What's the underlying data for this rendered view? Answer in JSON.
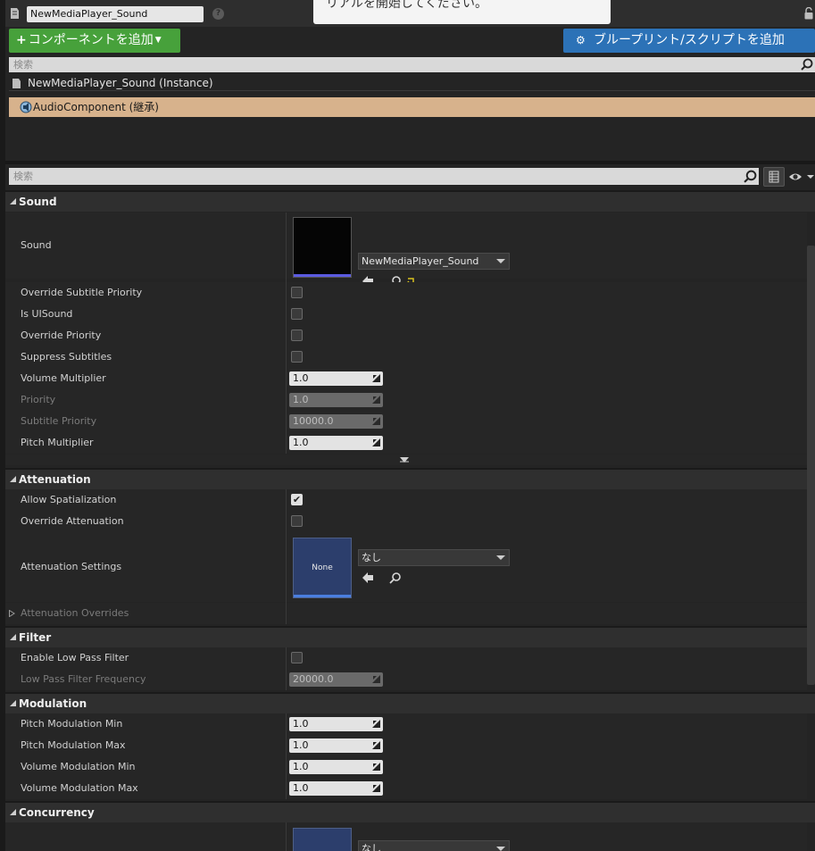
{
  "header": {
    "actor_name": "NewMediaPlayer_Sound",
    "tooltip_text": "リアルを開始してください。"
  },
  "toolbar": {
    "add_component_label": "コンポーネントを追加",
    "blueprint_label": "ブループリント/スクリプトを追加"
  },
  "component_search": {
    "placeholder": "検索"
  },
  "components": {
    "instance_label": "NewMediaPlayer_Sound (Instance)",
    "selected_label": "AudioComponent (継承)"
  },
  "details_search": {
    "placeholder": "検索"
  },
  "sections": {
    "sound": {
      "title": "Sound",
      "sound_label": "Sound",
      "sound_asset": "NewMediaPlayer_Sound",
      "override_subtitle_priority_label": "Override Subtitle Priority",
      "is_uisound_label": "Is UISound",
      "override_priority_label": "Override Priority",
      "suppress_subtitles_label": "Suppress Subtitles",
      "volume_multiplier_label": "Volume Multiplier",
      "volume_multiplier_value": "1.0",
      "priority_label": "Priority",
      "priority_value": "1.0",
      "subtitle_priority_label": "Subtitle Priority",
      "subtitle_priority_value": "10000.0",
      "pitch_multiplier_label": "Pitch Multiplier",
      "pitch_multiplier_value": "1.0"
    },
    "attenuation": {
      "title": "Attenuation",
      "allow_spatialization_label": "Allow Spatialization",
      "allow_spatialization_checked": true,
      "override_attenuation_label": "Override Attenuation",
      "attenuation_settings_label": "Attenuation Settings",
      "attenuation_settings_asset": "なし",
      "thumbnail_text": "None",
      "attenuation_overrides_label": "Attenuation Overrides"
    },
    "filter": {
      "title": "Filter",
      "enable_low_pass_label": "Enable Low Pass Filter",
      "low_pass_frequency_label": "Low Pass Filter Frequency",
      "low_pass_frequency_value": "20000.0"
    },
    "modulation": {
      "title": "Modulation",
      "pitch_min_label": "Pitch Modulation Min",
      "pitch_min_value": "1.0",
      "pitch_max_label": "Pitch Modulation Max",
      "pitch_max_value": "1.0",
      "volume_min_label": "Volume Modulation Min",
      "volume_min_value": "1.0",
      "volume_max_label": "Volume Modulation Max",
      "volume_max_value": "1.0"
    },
    "concurrency": {
      "title": "Concurrency",
      "asset": "なし"
    }
  },
  "colors": {
    "add_button": "#47a13b",
    "blueprint_button": "#2c72b7",
    "selected_component": "#d7b28c"
  }
}
